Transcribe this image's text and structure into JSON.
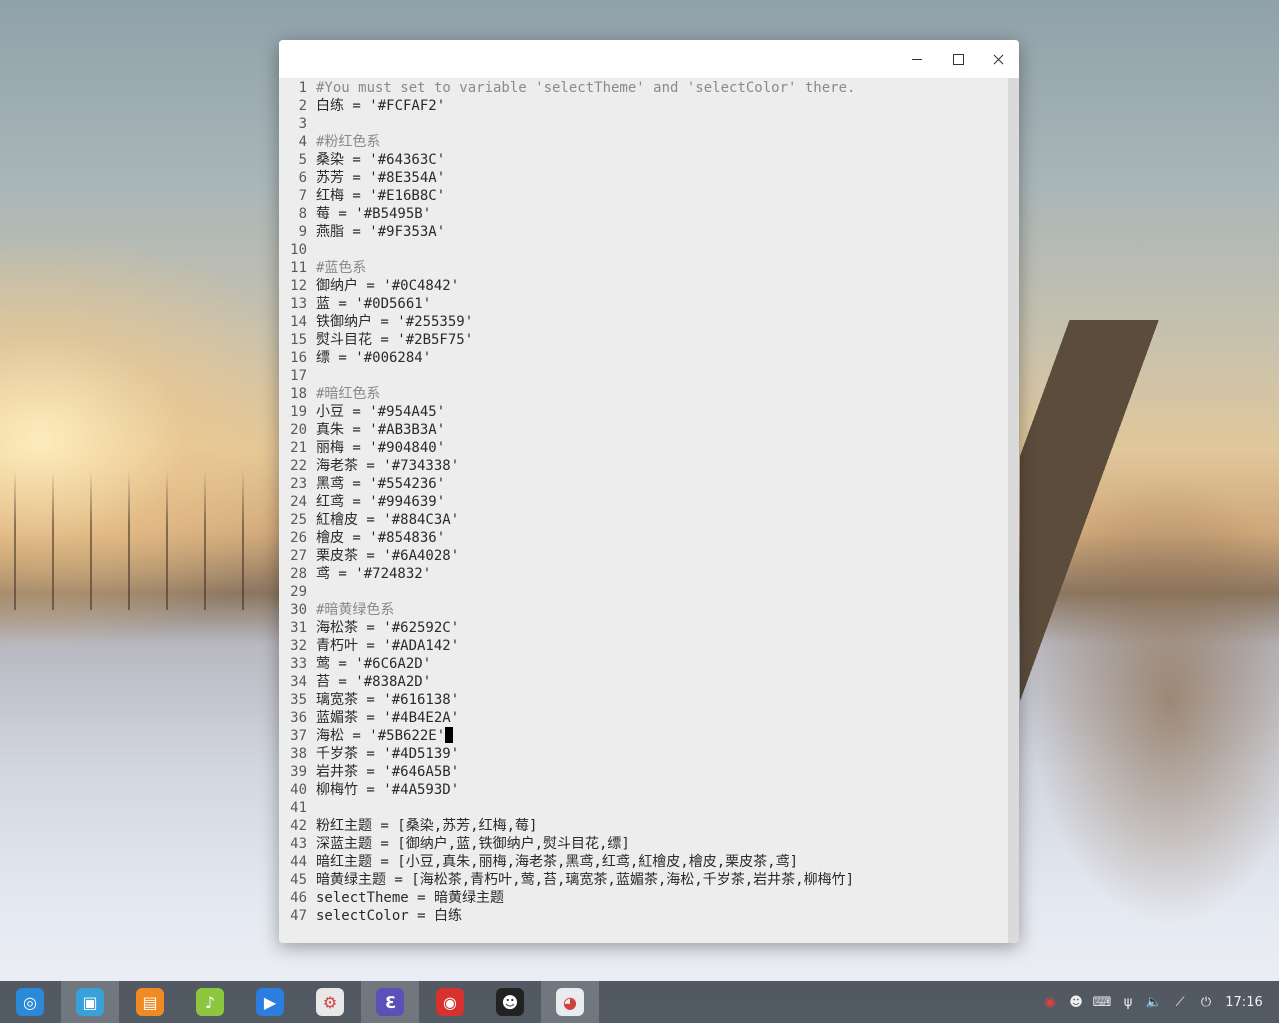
{
  "window": {
    "buttons": {
      "minimize": "minimize",
      "maximize": "maximize",
      "close": "close"
    }
  },
  "editor": {
    "cursor_line": 37,
    "lines": [
      {
        "n": "1",
        "text": "#You must set to variable 'selectTheme' and 'selectColor' there.",
        "comment": true
      },
      {
        "n": "2",
        "text": "白练 = '#FCFAF2'"
      },
      {
        "n": "3",
        "text": ""
      },
      {
        "n": "4",
        "text": "#粉红色系",
        "comment": true
      },
      {
        "n": "5",
        "text": "桑染 = '#64363C'"
      },
      {
        "n": "6",
        "text": "苏芳 = '#8E354A'"
      },
      {
        "n": "7",
        "text": "红梅 = '#E16B8C'"
      },
      {
        "n": "8",
        "text": "莓 = '#B5495B'"
      },
      {
        "n": "9",
        "text": "燕脂 = '#9F353A'"
      },
      {
        "n": "10",
        "text": ""
      },
      {
        "n": "11",
        "text": "#蓝色系",
        "comment": true
      },
      {
        "n": "12",
        "text": "御纳户 = '#0C4842'"
      },
      {
        "n": "13",
        "text": "蓝 = '#0D5661'"
      },
      {
        "n": "14",
        "text": "铁御纳户 = '#255359'"
      },
      {
        "n": "15",
        "text": "熨斗目花 = '#2B5F75'"
      },
      {
        "n": "16",
        "text": "缥 = '#006284'"
      },
      {
        "n": "17",
        "text": ""
      },
      {
        "n": "18",
        "text": "#暗红色系",
        "comment": true
      },
      {
        "n": "19",
        "text": "小豆 = '#954A45'"
      },
      {
        "n": "20",
        "text": "真朱 = '#AB3B3A'"
      },
      {
        "n": "21",
        "text": "丽梅 = '#904840'"
      },
      {
        "n": "22",
        "text": "海老茶 = '#734338'"
      },
      {
        "n": "23",
        "text": "黑鸢 = '#554236'"
      },
      {
        "n": "24",
        "text": "红鸢 = '#994639'"
      },
      {
        "n": "25",
        "text": "紅檜皮 = '#884C3A'"
      },
      {
        "n": "26",
        "text": "檜皮 = '#854836'"
      },
      {
        "n": "27",
        "text": "栗皮茶 = '#6A4028'"
      },
      {
        "n": "28",
        "text": "鸢 = '#724832'"
      },
      {
        "n": "29",
        "text": ""
      },
      {
        "n": "30",
        "text": "#暗黄绿色系",
        "comment": true
      },
      {
        "n": "31",
        "text": "海松茶 = '#62592C'"
      },
      {
        "n": "32",
        "text": "青朽叶 = '#ADA142'"
      },
      {
        "n": "33",
        "text": "莺 = '#6C6A2D'"
      },
      {
        "n": "34",
        "text": "苔 = '#838A2D'"
      },
      {
        "n": "35",
        "text": "璃宽茶 = '#616138'"
      },
      {
        "n": "36",
        "text": "蓝媚茶 = '#4B4E2A'"
      },
      {
        "n": "37",
        "text": "海松 = '#5B622E'"
      },
      {
        "n": "38",
        "text": "千岁茶 = '#4D5139'"
      },
      {
        "n": "39",
        "text": "岩井茶 = '#646A5B'"
      },
      {
        "n": "40",
        "text": "柳梅竹 = '#4A593D'"
      },
      {
        "n": "41",
        "text": ""
      },
      {
        "n": "42",
        "text": "粉红主题 = [桑染,苏芳,红梅,莓]"
      },
      {
        "n": "43",
        "text": "深蓝主题 = [御纳户,蓝,铁御纳户,熨斗目花,缥]"
      },
      {
        "n": "44",
        "text": "暗红主题 = [小豆,真朱,丽梅,海老茶,黑鸢,红鸢,紅檜皮,檜皮,栗皮茶,鸢]"
      },
      {
        "n": "45",
        "text": "暗黄绿主题 = [海松茶,青朽叶,莺,苔,璃宽茶,蓝媚茶,海松,千岁茶,岩井茶,柳梅竹]"
      },
      {
        "n": "46",
        "text": "selectTheme = 暗黄绿主题"
      },
      {
        "n": "47",
        "text": "selectColor = 白练"
      }
    ]
  },
  "taskbar": {
    "apps": [
      {
        "name": "launcher-icon",
        "color": "#2a8ad8",
        "glyph": "◎",
        "active": false
      },
      {
        "name": "file-manager-icon",
        "color": "#3aa0d8",
        "glyph": "▣",
        "active": true
      },
      {
        "name": "app-store-icon",
        "color": "#f08a24",
        "glyph": "▤",
        "active": false
      },
      {
        "name": "music-icon",
        "color": "#8dc63f",
        "glyph": "♪",
        "active": false
      },
      {
        "name": "video-icon",
        "color": "#2b7de0",
        "glyph": "▶",
        "active": false
      },
      {
        "name": "settings-icon",
        "color": "#e8e8e8",
        "glyph": "⚙",
        "active": false
      },
      {
        "name": "editor-icon",
        "color": "#5b4fb8",
        "glyph": "ℇ",
        "active": true
      },
      {
        "name": "netease-music-icon",
        "color": "#d8322e",
        "glyph": "◉",
        "active": false
      },
      {
        "name": "qq-icon",
        "color": "#222222",
        "glyph": "☻",
        "active": false
      },
      {
        "name": "chrome-icon",
        "color": "#e9ecef",
        "glyph": "◕",
        "active": true
      }
    ],
    "tray": [
      {
        "name": "netease-tray-icon",
        "glyph": "◉"
      },
      {
        "name": "qq-tray-icon",
        "glyph": "☻"
      },
      {
        "name": "keyboard-icon",
        "glyph": "⌨"
      },
      {
        "name": "usb-icon",
        "glyph": "ψ"
      },
      {
        "name": "volume-icon",
        "glyph": "🔈"
      },
      {
        "name": "network-icon",
        "glyph": "⟋"
      },
      {
        "name": "power-icon",
        "glyph": "⏻"
      }
    ],
    "clock": "17:16"
  }
}
